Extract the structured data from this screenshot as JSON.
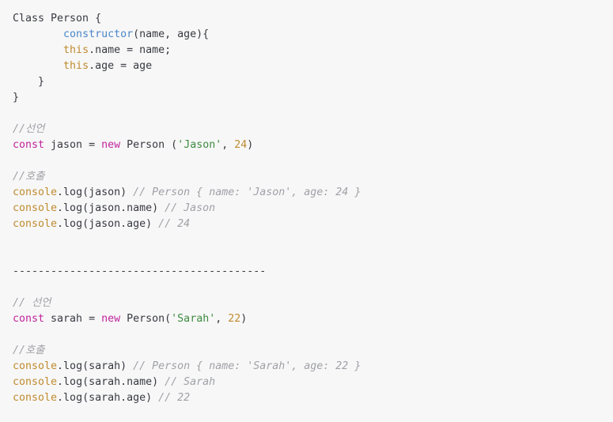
{
  "editor": {
    "language": "javascript",
    "background_color": "#f7f7f7",
    "default_text_color": "#383a42",
    "colors": {
      "keyword": "#c0259d",
      "function": "#4a86c8",
      "this_keyword": "#c08b30",
      "number": "#c08b30",
      "object": "#c08b30",
      "string": "#3d8b40",
      "comment": "#a0a1a7"
    }
  },
  "code": {
    "lines": [
      {
        "n": 1,
        "text": "Class Person {",
        "tokens": [
          {
            "t": "Class Person {",
            "c": "tok-plain"
          }
        ]
      },
      {
        "n": 2,
        "text": "        constructor(name, age){",
        "tokens": [
          {
            "t": "        ",
            "c": "tok-plain"
          },
          {
            "t": "constructor",
            "c": "tok-fn"
          },
          {
            "t": "(name, age){",
            "c": "tok-plain"
          }
        ]
      },
      {
        "n": 3,
        "text": "        this.name = name;",
        "tokens": [
          {
            "t": "        ",
            "c": "tok-plain"
          },
          {
            "t": "this",
            "c": "tok-this"
          },
          {
            "t": ".name = name;",
            "c": "tok-plain"
          }
        ]
      },
      {
        "n": 4,
        "text": "        this.age = age",
        "tokens": [
          {
            "t": "        ",
            "c": "tok-plain"
          },
          {
            "t": "this",
            "c": "tok-this"
          },
          {
            "t": ".age = age",
            "c": "tok-plain"
          }
        ]
      },
      {
        "n": 5,
        "text": "    }",
        "tokens": [
          {
            "t": "    }",
            "c": "tok-plain"
          }
        ]
      },
      {
        "n": 6,
        "text": "}",
        "tokens": [
          {
            "t": "}",
            "c": "tok-plain"
          }
        ]
      },
      {
        "n": 7,
        "text": "",
        "tokens": []
      },
      {
        "n": 8,
        "text": "//선언",
        "tokens": [
          {
            "t": "//선언",
            "c": "tok-comment"
          }
        ]
      },
      {
        "n": 9,
        "text": "const jason = new Person ('Jason', 24)",
        "tokens": [
          {
            "t": "const",
            "c": "tok-kw"
          },
          {
            "t": " jason = ",
            "c": "tok-plain"
          },
          {
            "t": "new",
            "c": "tok-kw"
          },
          {
            "t": " Person (",
            "c": "tok-plain"
          },
          {
            "t": "'Jason'",
            "c": "tok-str"
          },
          {
            "t": ", ",
            "c": "tok-plain"
          },
          {
            "t": "24",
            "c": "tok-num"
          },
          {
            "t": ")",
            "c": "tok-plain"
          }
        ]
      },
      {
        "n": 10,
        "text": "",
        "tokens": []
      },
      {
        "n": 11,
        "text": "//호출",
        "tokens": [
          {
            "t": "//호출",
            "c": "tok-comment"
          }
        ]
      },
      {
        "n": 12,
        "text": "console.log(jason) // Person { name: 'Jason', age: 24 }",
        "tokens": [
          {
            "t": "console",
            "c": "tok-obj"
          },
          {
            "t": ".log(jason) ",
            "c": "tok-plain"
          },
          {
            "t": "// Person { name: 'Jason', age: 24 }",
            "c": "tok-comment"
          }
        ]
      },
      {
        "n": 13,
        "text": "console.log(jason.name) // Jason",
        "tokens": [
          {
            "t": "console",
            "c": "tok-obj"
          },
          {
            "t": ".log(jason.name) ",
            "c": "tok-plain"
          },
          {
            "t": "// Jason",
            "c": "tok-comment"
          }
        ]
      },
      {
        "n": 14,
        "text": "console.log(jason.age) // 24",
        "tokens": [
          {
            "t": "console",
            "c": "tok-obj"
          },
          {
            "t": ".log(jason.age) ",
            "c": "tok-plain"
          },
          {
            "t": "// 24",
            "c": "tok-comment"
          }
        ]
      },
      {
        "n": 15,
        "text": "",
        "tokens": []
      },
      {
        "n": 16,
        "text": "",
        "tokens": []
      },
      {
        "n": 17,
        "text": "----------------------------------------",
        "tokens": [
          {
            "t": "----------------------------------------",
            "c": "tok-rule"
          }
        ]
      },
      {
        "n": 18,
        "text": "",
        "tokens": []
      },
      {
        "n": 19,
        "text": "// 선언",
        "tokens": [
          {
            "t": "// 선언",
            "c": "tok-comment"
          }
        ]
      },
      {
        "n": 20,
        "text": "const sarah = new Person('Sarah', 22)",
        "tokens": [
          {
            "t": "const",
            "c": "tok-kw"
          },
          {
            "t": " sarah = ",
            "c": "tok-plain"
          },
          {
            "t": "new",
            "c": "tok-kw"
          },
          {
            "t": " Person(",
            "c": "tok-plain"
          },
          {
            "t": "'Sarah'",
            "c": "tok-str"
          },
          {
            "t": ", ",
            "c": "tok-plain"
          },
          {
            "t": "22",
            "c": "tok-num"
          },
          {
            "t": ")",
            "c": "tok-plain"
          }
        ]
      },
      {
        "n": 21,
        "text": "",
        "tokens": []
      },
      {
        "n": 22,
        "text": "//호출",
        "tokens": [
          {
            "t": "//호출",
            "c": "tok-comment"
          }
        ]
      },
      {
        "n": 23,
        "text": "console.log(sarah) // Person { name: 'Sarah', age: 22 }",
        "tokens": [
          {
            "t": "console",
            "c": "tok-obj"
          },
          {
            "t": ".log(sarah) ",
            "c": "tok-plain"
          },
          {
            "t": "// Person { name: 'Sarah', age: 22 }",
            "c": "tok-comment"
          }
        ]
      },
      {
        "n": 24,
        "text": "console.log(sarah.name) // Sarah",
        "tokens": [
          {
            "t": "console",
            "c": "tok-obj"
          },
          {
            "t": ".log(sarah.name) ",
            "c": "tok-plain"
          },
          {
            "t": "// Sarah",
            "c": "tok-comment"
          }
        ]
      },
      {
        "n": 25,
        "text": "console.log(sarah.age) // 22",
        "tokens": [
          {
            "t": "console",
            "c": "tok-obj"
          },
          {
            "t": ".log(sarah.age) ",
            "c": "tok-plain"
          },
          {
            "t": "// 22",
            "c": "tok-comment"
          }
        ]
      }
    ]
  }
}
